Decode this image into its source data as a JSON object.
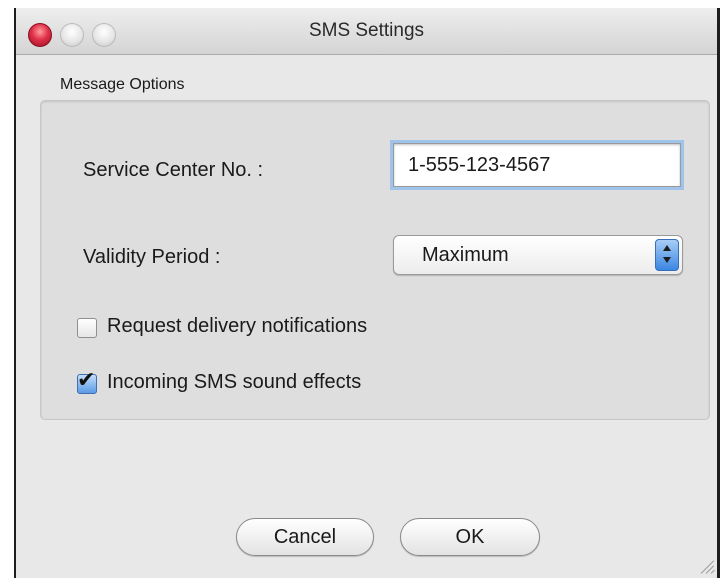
{
  "window": {
    "title": "SMS Settings",
    "controls": [
      "close",
      "minimize",
      "zoom"
    ]
  },
  "group": {
    "label": "Message Options",
    "service_center": {
      "label": "Service Center No. :",
      "value": "1-555-123-4567"
    },
    "validity_period": {
      "label": "Validity Period :",
      "selected": "Maximum"
    },
    "delivery_notifications": {
      "label": "Request delivery notifications",
      "checked": false
    },
    "sound_effects": {
      "label": "Incoming SMS sound effects",
      "checked": true
    }
  },
  "buttons": {
    "cancel": "Cancel",
    "ok": "OK"
  },
  "colors": {
    "close_button": "#e0314a",
    "focus_ring": "#9fc3ea",
    "select_arrows": "#3b86e2"
  }
}
